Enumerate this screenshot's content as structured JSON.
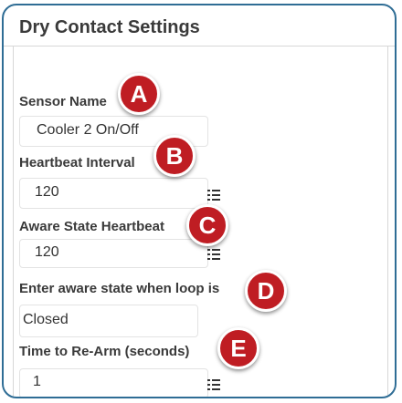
{
  "header": {
    "title": "Dry Contact Settings"
  },
  "fields": {
    "sensor_name": {
      "label": "Sensor Name",
      "value": "Cooler 2 On/Off"
    },
    "heartbeat": {
      "label": "Heartbeat Interval",
      "value": "120",
      "icon": "list-icon"
    },
    "aware_heartbeat": {
      "label": "Aware State Heartbeat",
      "value": "120",
      "icon": "list-icon"
    },
    "aware_state": {
      "label": "Enter aware state when loop is",
      "value": "Closed"
    },
    "rearm": {
      "label": "Time to Re-Arm (seconds)",
      "value": "1",
      "icon": "list-icon"
    }
  },
  "markers": {
    "a": "A",
    "b": "B",
    "c": "C",
    "d": "D",
    "e": "E"
  },
  "colors": {
    "border": "#2f6d95",
    "marker": "#bf1d23",
    "text": "#3a3a3a"
  }
}
